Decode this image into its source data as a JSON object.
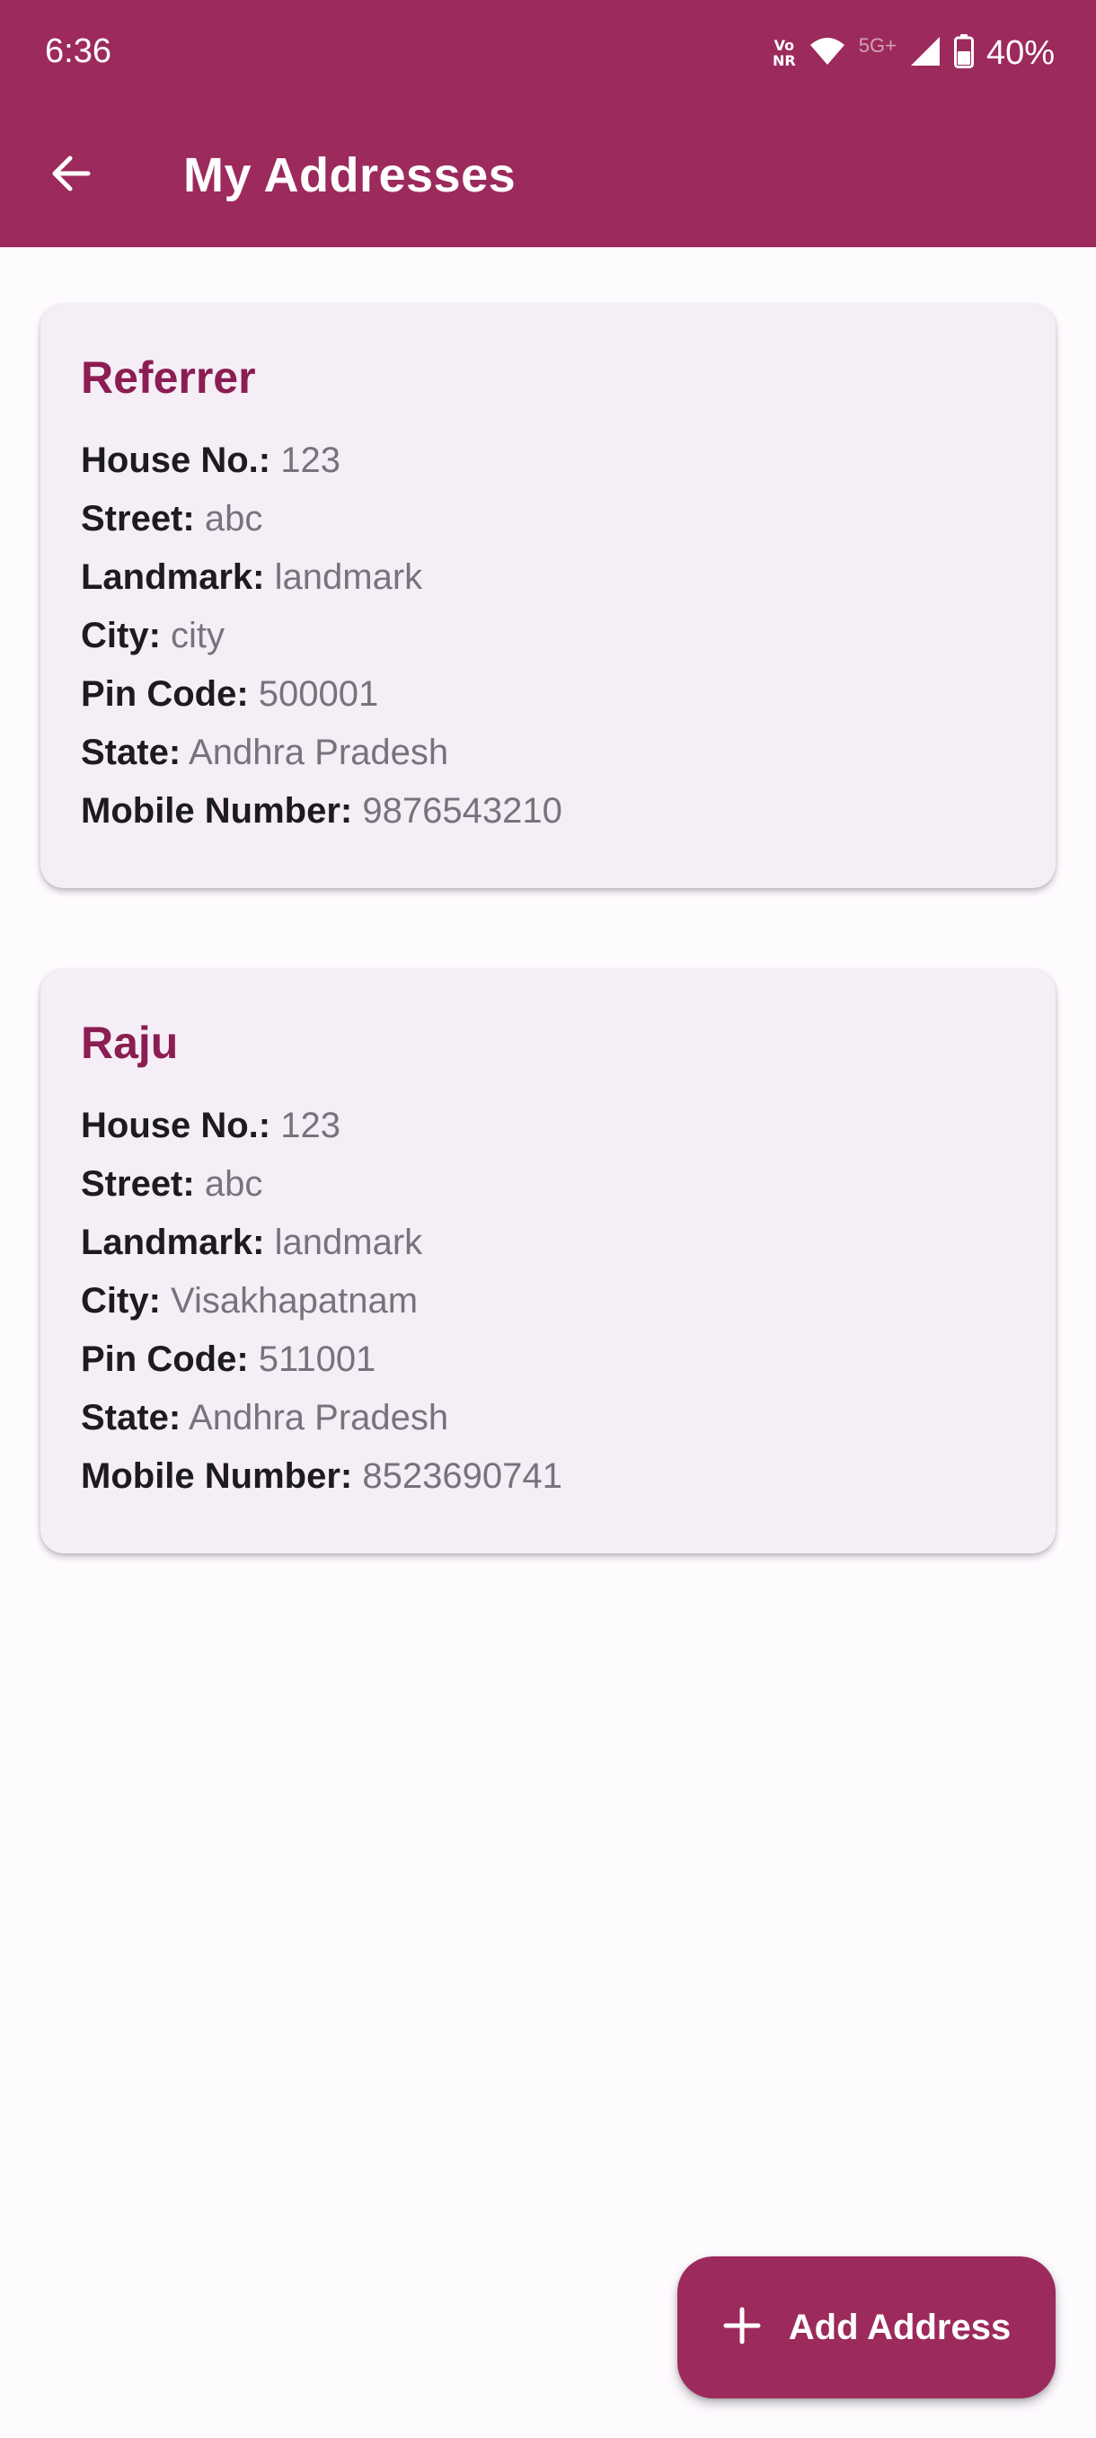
{
  "status_bar": {
    "time": "6:36",
    "volte_label_top": "Vo",
    "volte_label_bottom": "NR",
    "network_type": "5G+",
    "battery_percent": "40%",
    "icons": [
      "volte-icon",
      "wifi-icon",
      "signal-icon",
      "battery-icon"
    ]
  },
  "app_bar": {
    "title": "My Addresses",
    "back_icon": "arrow-back-icon",
    "color": "#9c2a5c"
  },
  "addresses": [
    {
      "name": "Referrer",
      "fields": [
        {
          "label": "House No.:",
          "value": "123"
        },
        {
          "label": "Street:",
          "value": "abc"
        },
        {
          "label": "Landmark:",
          "value": "landmark"
        },
        {
          "label": "City:",
          "value": "city"
        },
        {
          "label": "Pin Code:",
          "value": "500001"
        },
        {
          "label": "State:",
          "value": "Andhra Pradesh"
        },
        {
          "label": "Mobile Number:",
          "value": "9876543210"
        }
      ]
    },
    {
      "name": "Raju",
      "fields": [
        {
          "label": "House No.:",
          "value": "123"
        },
        {
          "label": "Street:",
          "value": "abc"
        },
        {
          "label": "Landmark:",
          "value": "landmark"
        },
        {
          "label": "City:",
          "value": "Visakhapatnam"
        },
        {
          "label": "Pin Code:",
          "value": "511001"
        },
        {
          "label": "State:",
          "value": "Andhra Pradesh"
        },
        {
          "label": "Mobile Number:",
          "value": "8523690741"
        }
      ]
    }
  ],
  "fab": {
    "label": "Add Address",
    "icon": "plus-icon"
  },
  "colors": {
    "primary": "#9c2a5c",
    "card_title": "#8b1d53",
    "card_background": "#f5eef6",
    "label_text": "#1c1b1f",
    "value_text": "#77737c"
  }
}
